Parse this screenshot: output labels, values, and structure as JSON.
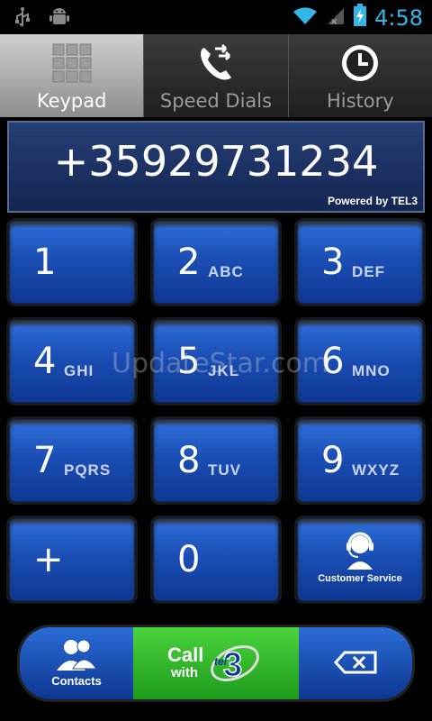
{
  "status_bar": {
    "time": "4:58",
    "icons": [
      "usb-icon",
      "android-icon",
      "wifi-icon",
      "signal-icon",
      "battery-charging-icon"
    ]
  },
  "tabs": [
    {
      "label": "Keypad",
      "icon": "keypad-grid-icon",
      "active": true
    },
    {
      "label": "Speed Dials",
      "icon": "speed-dial-icon",
      "active": false
    },
    {
      "label": "History",
      "icon": "clock-icon",
      "active": false
    }
  ],
  "display": {
    "number": "+35929731234",
    "powered_by": "Powered by TEL3"
  },
  "keypad": {
    "keys": [
      {
        "digit": "1",
        "letters": ""
      },
      {
        "digit": "2",
        "letters": "ABC"
      },
      {
        "digit": "3",
        "letters": "DEF"
      },
      {
        "digit": "4",
        "letters": "GHI"
      },
      {
        "digit": "5",
        "letters": "JKL"
      },
      {
        "digit": "6",
        "letters": "MNO"
      },
      {
        "digit": "7",
        "letters": "PQRS"
      },
      {
        "digit": "8",
        "letters": "TUV"
      },
      {
        "digit": "9",
        "letters": "WXYZ"
      },
      {
        "digit": "+",
        "letters": ""
      },
      {
        "digit": "0",
        "letters": ""
      }
    ],
    "customer_service_label": "Customer Service"
  },
  "bottom_bar": {
    "contacts_label": "Contacts",
    "call_label": "Call",
    "with_label": "with",
    "tel3_logo": "tel 3"
  },
  "watermark": "UpdateStar.com",
  "colors": {
    "accent_blue": "#33b5e5",
    "key_blue": "#1b4fb5",
    "call_green": "#2db52a"
  }
}
